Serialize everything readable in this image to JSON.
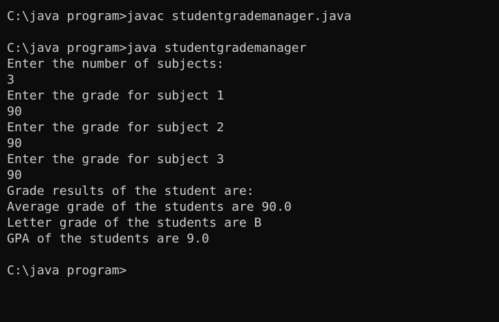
{
  "console": {
    "lines": [
      "C:\\java program>javac studentgrademanager.java",
      "",
      "C:\\java program>java studentgrademanager",
      "Enter the number of subjects:",
      "3",
      "Enter the grade for subject 1",
      "90",
      "Enter the grade for subject 2",
      "90",
      "Enter the grade for subject 3",
      "90",
      "Grade results of the student are:",
      "Average grade of the students are 90.0",
      "Letter grade of the students are B",
      "GPA of the students are 9.0",
      "",
      "C:\\java program>"
    ]
  },
  "colors": {
    "background": "#0c0c0c",
    "text": "#cccccc"
  }
}
